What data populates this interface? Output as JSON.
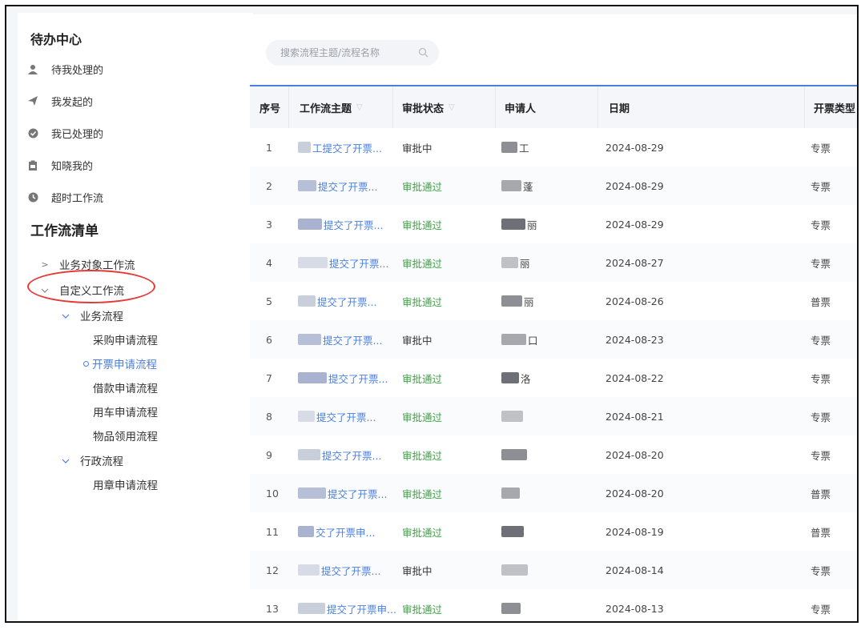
{
  "sidebar": {
    "todo_title": "待办中心",
    "todo_items": [
      {
        "label": "待我处理的",
        "icon": "user-icon"
      },
      {
        "label": "我发起的",
        "icon": "send-icon"
      },
      {
        "label": "我已处理的",
        "icon": "check-circle-icon"
      },
      {
        "label": "知晓我的",
        "icon": "clipboard-icon"
      },
      {
        "label": "超时工作流",
        "icon": "clock-icon"
      }
    ],
    "workflow_title": "工作流清单",
    "tree": {
      "business_object": "业务对象工作流",
      "custom": "自定义工作流",
      "business_process": "业务流程",
      "business_children": [
        "采购申请流程",
        "开票申请流程",
        "借款申请流程",
        "用车申请流程",
        "物品领用流程"
      ],
      "admin_process": "行政流程",
      "admin_children": [
        "用章申请流程"
      ]
    }
  },
  "search": {
    "placeholder": "搜索流程主题/流程名称"
  },
  "table": {
    "headers": {
      "idx": "序号",
      "title": "工作流主题",
      "status": "审批状态",
      "applicant": "申请人",
      "date": "日期",
      "type": "开票类型"
    },
    "rows": [
      {
        "idx": "1",
        "title": "工提交了开票...",
        "status": "审批中",
        "applicant": "工",
        "date": "2024-08-29",
        "type": "专票"
      },
      {
        "idx": "2",
        "title": "提交了开票...",
        "status": "审批通过",
        "applicant": "蓬",
        "date": "2024-08-29",
        "type": "专票"
      },
      {
        "idx": "3",
        "title": "提交了开票...",
        "status": "审批通过",
        "applicant": "丽",
        "date": "2024-08-29",
        "type": "专票"
      },
      {
        "idx": "4",
        "title": "提交了开票...",
        "status": "审批通过",
        "applicant": "丽",
        "date": "2024-08-27",
        "type": "专票"
      },
      {
        "idx": "5",
        "title": "提交了开票...",
        "status": "审批通过",
        "applicant": "丽",
        "date": "2024-08-26",
        "type": "普票"
      },
      {
        "idx": "6",
        "title": "提交了开票...",
        "status": "审批中",
        "applicant": "口",
        "date": "2024-08-23",
        "type": "专票"
      },
      {
        "idx": "7",
        "title": "提交了开票...",
        "status": "审批通过",
        "applicant": "洛",
        "date": "2024-08-22",
        "type": "专票"
      },
      {
        "idx": "8",
        "title": "提交了开票...",
        "status": "审批通过",
        "applicant": "",
        "date": "2024-08-21",
        "type": "专票"
      },
      {
        "idx": "9",
        "title": "提交了开票...",
        "status": "审批通过",
        "applicant": "",
        "date": "2024-08-20",
        "type": "专票"
      },
      {
        "idx": "10",
        "title": "提交了开票...",
        "status": "审批通过",
        "applicant": "",
        "date": "2024-08-20",
        "type": "普票"
      },
      {
        "idx": "11",
        "title": "交了开票申...",
        "status": "审批通过",
        "applicant": "",
        "date": "2024-08-19",
        "type": "普票"
      },
      {
        "idx": "12",
        "title": "提交了开票...",
        "status": "审批中",
        "applicant": "",
        "date": "2024-08-14",
        "type": "专票"
      },
      {
        "idx": "13",
        "title": "提交了开票申...",
        "status": "审批通过",
        "applicant": "",
        "date": "2024-08-13",
        "type": "专票"
      }
    ]
  },
  "colors": {
    "accent": "#4a7fe0",
    "approved": "#43a047",
    "highlight": "#e53935"
  }
}
